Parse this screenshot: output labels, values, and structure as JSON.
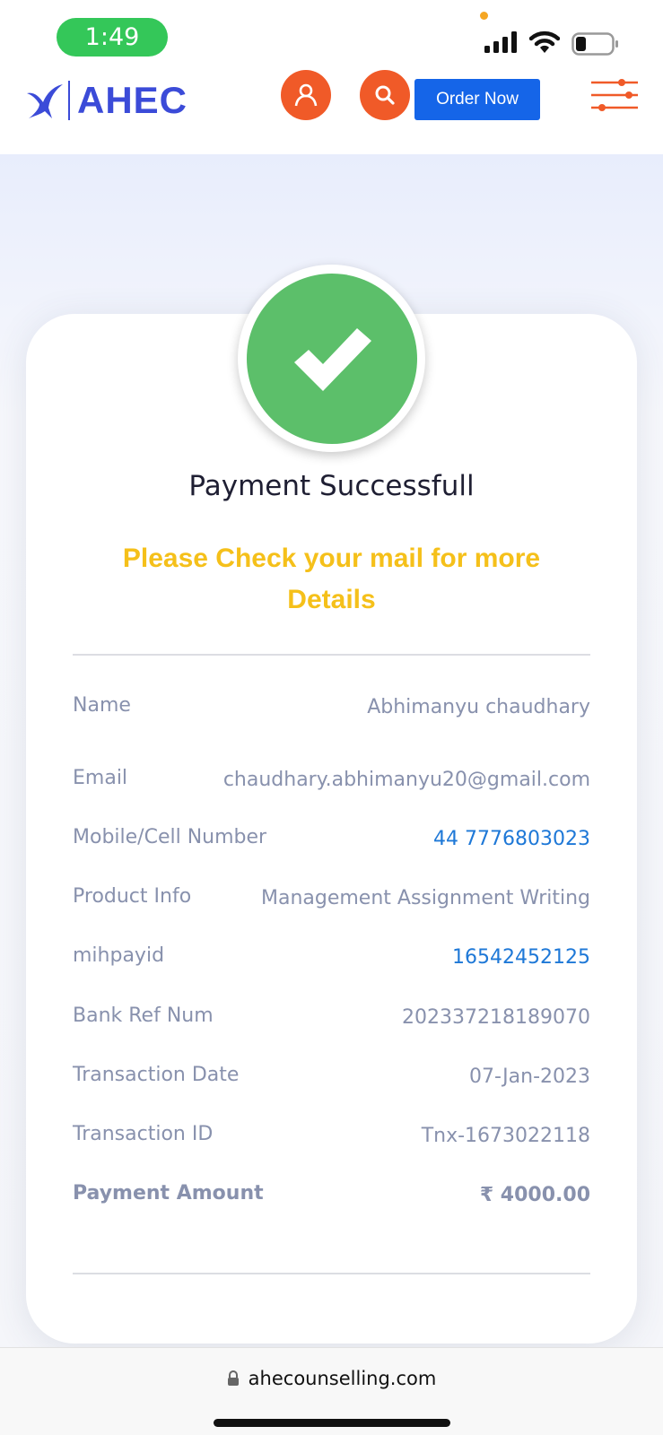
{
  "status_bar": {
    "time": "1:49"
  },
  "header": {
    "logo_text": "AHEC",
    "order_button": "Order Now",
    "user_icon": "user-icon",
    "search_icon": "search-icon",
    "menu_icon": "filter-sliders-icon",
    "accent": "#f05a28",
    "brand": "#3b4bd8"
  },
  "card": {
    "title": "Payment Successfull",
    "notice": "Please Check your mail for more Details",
    "success_color": "#5cbf6a",
    "rows": [
      {
        "label": "Name",
        "value": "Abhimanyu chaudhary"
      },
      {
        "label": "Email",
        "value": "chaudhary.abhimanyu20@gmail.com"
      },
      {
        "label": "Mobile/Cell Number",
        "value": "44 7776803023"
      },
      {
        "label": "Product Info",
        "value": "Management Assignment Writing"
      },
      {
        "label": "mihpayid",
        "value": "16542452125"
      },
      {
        "label": "Bank Ref Num",
        "value": "202337218189070"
      },
      {
        "label": "Transaction Date",
        "value": "07-Jan-2023"
      },
      {
        "label": "Transaction ID",
        "value": "Tnx-1673022118"
      },
      {
        "label": "Payment Amount",
        "value": "₹ 4000.00"
      }
    ]
  },
  "browser": {
    "url": "ahecounselling.com"
  }
}
